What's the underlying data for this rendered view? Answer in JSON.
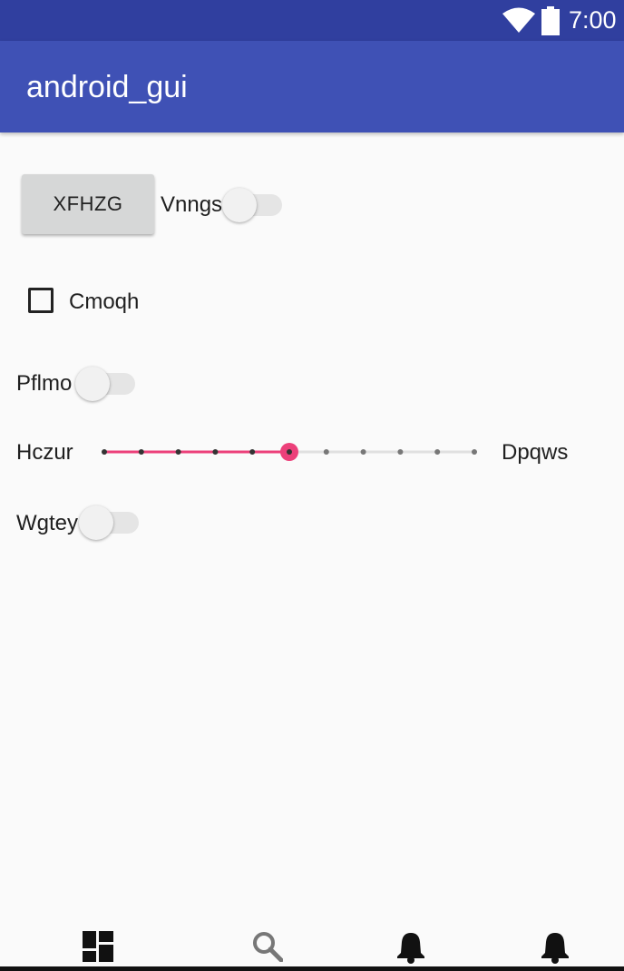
{
  "status_bar": {
    "time": "7:00"
  },
  "app_bar": {
    "title": "android_gui"
  },
  "button": {
    "label": "XFHZG"
  },
  "switch_vnngs": {
    "label": "Vnngs",
    "checked": false
  },
  "checkbox_cmoqh": {
    "label": "Cmoqh",
    "checked": false
  },
  "switch_pflmo": {
    "label": "Pflmo",
    "checked": false
  },
  "slider": {
    "start_label": "Hczur",
    "end_label": "Dpqws",
    "steps": 10,
    "value": 5,
    "accent_color": "#ec407a"
  },
  "switch_wgtey": {
    "label": "Wgtey",
    "checked": false
  },
  "bottom_nav": {
    "items": [
      {
        "icon": "dashboard-icon"
      },
      {
        "icon": "search-icon"
      },
      {
        "icon": "notifications-icon"
      },
      {
        "icon": "notifications-icon"
      }
    ]
  },
  "colors": {
    "primary": "#3f51b5",
    "primary_dark": "#303f9f",
    "accent": "#ec407a"
  }
}
